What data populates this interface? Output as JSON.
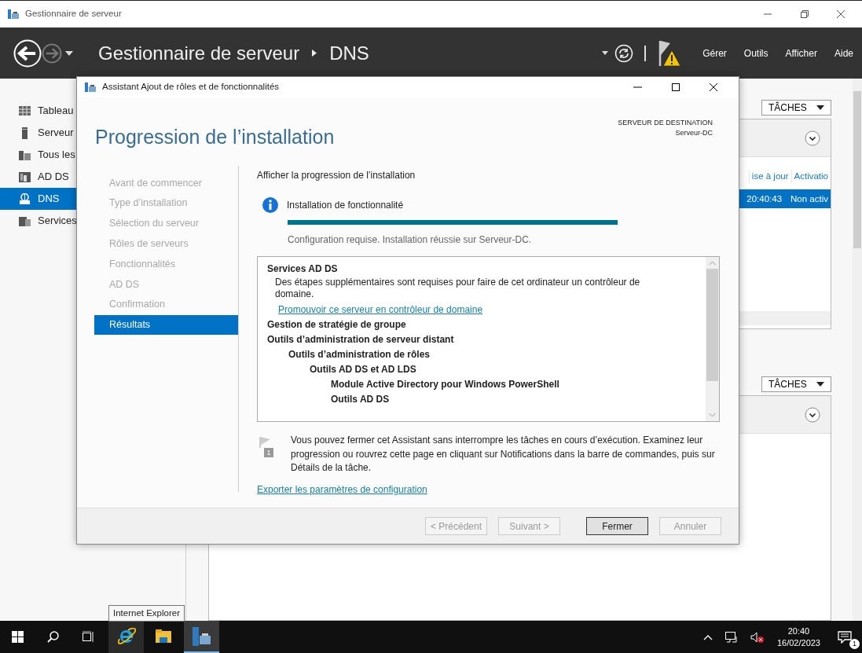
{
  "window": {
    "title": "Gestionnaire de serveur"
  },
  "header": {
    "nav_buttons": [
      {
        "kind": "back",
        "disabled": false
      },
      {
        "kind": "forward",
        "disabled": true
      }
    ],
    "breadcrumb": [
      "Gestionnaire de serveur",
      "DNS"
    ],
    "notification_warning": true,
    "menu": [
      "Gérer",
      "Outils",
      "Afficher",
      "Aide"
    ]
  },
  "sidebar": {
    "items": [
      {
        "kind": "dashboard",
        "label": "Tableau",
        "selected": false
      },
      {
        "kind": "server",
        "label": "Serveur",
        "selected": false
      },
      {
        "kind": "servers",
        "label": "Tous les",
        "selected": false
      },
      {
        "kind": "adds",
        "label": "AD DS",
        "selected": false
      },
      {
        "kind": "dns",
        "label": "DNS",
        "selected": true
      },
      {
        "kind": "services",
        "label": "Services",
        "selected": false
      }
    ]
  },
  "panels": [
    {
      "tasks": "TÂCHES",
      "columns": [
        "ise à jour",
        "Activatio"
      ],
      "rows": [
        {
          "cells": [
            "20:40:43",
            "Non activ"
          ],
          "selected": true
        }
      ]
    },
    {
      "tasks": "TÂCHES"
    }
  ],
  "dialog": {
    "title": "Assistant Ajout de rôles et de fonctionnalités",
    "heading": "Progression de l’installation",
    "destination_label": "SERVEUR DE DESTINATION",
    "destination": "Serveur-DC",
    "steps": [
      {
        "label": "Avant de commencer",
        "selected": false
      },
      {
        "label": "Type d’installation",
        "selected": false
      },
      {
        "label": "Sélection du serveur",
        "selected": false
      },
      {
        "label": "Rôles de serveurs",
        "selected": false
      },
      {
        "label": "Fonctionnalités",
        "selected": false
      },
      {
        "label": "AD DS",
        "selected": false
      },
      {
        "label": "Confirmation",
        "selected": false
      },
      {
        "label": "Résultats",
        "selected": true
      }
    ],
    "section_title": "Afficher la progression de l’installation",
    "status": {
      "title": "Installation de fonctionnalité",
      "level": 1,
      "message": "Configuration requise. Installation réussie sur Serveur-DC."
    },
    "results": [
      {
        "kind": "item",
        "label": "Services AD DS",
        "children": [
          {
            "kind": "text",
            "label": "Des étapes supplémentaires sont requises pour faire de cet ordinateur un contrôleur de domaine."
          },
          {
            "kind": "link",
            "label": "Promouvoir ce serveur en contrôleur de domaine"
          }
        ]
      },
      {
        "kind": "item",
        "label": "Gestion de stratégie de groupe"
      },
      {
        "kind": "item",
        "label": "Outils d’administration de serveur distant",
        "children": [
          {
            "kind": "item",
            "label": "Outils d’administration de rôles",
            "children": [
              {
                "kind": "item",
                "label": "Outils AD DS et AD LDS",
                "children": [
                  {
                    "kind": "item",
                    "label": "Module Active Directory pour Windows PowerShell"
                  },
                  {
                    "kind": "item",
                    "label": "Outils AD DS"
                  }
                ]
              }
            ]
          }
        ]
      }
    ],
    "note": "Vous pouvez fermer cet Assistant sans interrompre les tâches en cours d’exécution. Examinez leur progression ou rouvrez cette page en cliquant sur Notifications dans la barre de commandes, puis sur Détails de la tâche.",
    "note_badge": "1",
    "export_link": "Exporter les paramètres de configuration",
    "buttons": [
      {
        "label": "< Précédent",
        "disabled": true,
        "default": false
      },
      {
        "label": "Suivant >",
        "disabled": true,
        "default": false
      },
      {
        "label": "Fermer",
        "disabled": false,
        "default": true
      },
      {
        "label": "Annuler",
        "disabled": true,
        "default": false
      }
    ]
  },
  "tooltip": "Internet Explorer",
  "taskbar": {
    "apps": [
      {
        "kind": "ie",
        "active": false
      },
      {
        "kind": "explorer",
        "active": false
      },
      {
        "kind": "server-manager",
        "active": true
      }
    ],
    "time": "20:40",
    "date": "16/02/2023",
    "notification_count": "1"
  }
}
